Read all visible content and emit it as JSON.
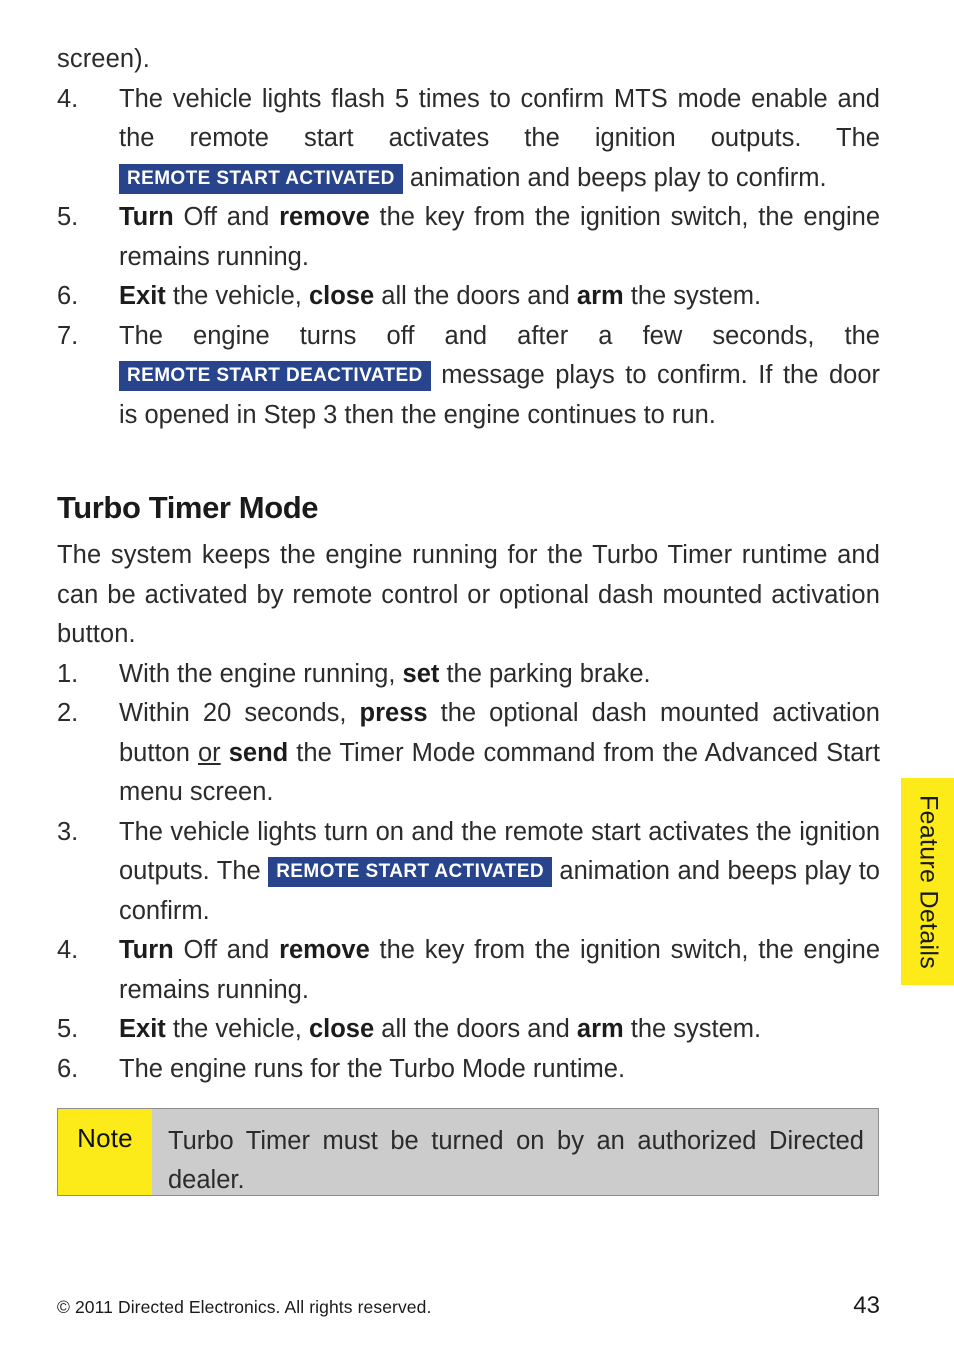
{
  "document": {
    "page_number": "43",
    "copyright": "© 2011 Directed Electronics. All rights reserved."
  },
  "side_tab": {
    "label": "Feature Details",
    "background_color": "#fdeb19"
  },
  "badges": {
    "activated": "REMOTE START ACTIVATED",
    "deactivated": "REMOTE START DEACTIVATED",
    "background_color": "#28448c",
    "text_color": "#ffffff"
  },
  "continued_paragraph": {
    "text": "screen)."
  },
  "mts_steps": [
    {
      "number": "4.",
      "part1": "The vehicle lights flash 5 times to confirm MTS mode enable and the remote start activates the ignition outputs. The ",
      "badge": "REMOTE START ACTIVATED",
      "part2": " animation and beeps play to confirm."
    },
    {
      "number": "5.",
      "b1": "Turn",
      "t1": " Off and ",
      "b2": "remove",
      "t2": " the key from the ignition switch, the engine remains running."
    },
    {
      "number": "6.",
      "b1": "Exit",
      "t1": " the vehicle, ",
      "b2": "close",
      "t2": " all the doors and ",
      "b3": "arm",
      "t3": " the system."
    },
    {
      "number": "7.",
      "part1": "The engine turns off and after a few seconds, the ",
      "badge": "REMOTE START DEACTIVATED",
      "part2": " message plays to confirm. If the door is opened in Step 3 then the engine continues to run."
    }
  ],
  "turbo_section": {
    "heading": "Turbo Timer Mode",
    "intro": "The system keeps the engine running for the Turbo Timer runtime and can be activated by remote control or optional dash mounted activation button.",
    "steps": [
      {
        "number": "1.",
        "t1": "With the engine running, ",
        "b1": "set",
        "t2": " the parking brake."
      },
      {
        "number": "2.",
        "t1": "Within 20 seconds, ",
        "b1": "press",
        "t2": " the optional dash mounted activation button ",
        "u1": "or",
        "t3": " ",
        "b2": "send",
        "t4": " the Timer Mode command from the Advanced Start menu screen."
      },
      {
        "number": "3.",
        "part1": "The vehicle lights turn on and the remote start activates the ignition outputs. The ",
        "badge": "REMOTE START ACTIVATED",
        "part2": " animation and beeps play to confirm."
      },
      {
        "number": "4.",
        "b1": "Turn",
        "t1": " Off and ",
        "b2": "remove",
        "t2": " the key from the ignition switch, the engine remains running."
      },
      {
        "number": "5.",
        "b1": "Exit",
        "t1": " the vehicle, ",
        "b2": "close",
        "t2": " all the doors and ",
        "b3": "arm",
        "t3": " the system."
      },
      {
        "number": "6.",
        "t1": "The engine runs for the Turbo Mode runtime."
      }
    ]
  },
  "note": {
    "label": "Note",
    "text": "Turbo Timer must be turned on by an authorized Directed dealer.",
    "label_background": "#fdeb19",
    "body_background": "#cccccc"
  }
}
